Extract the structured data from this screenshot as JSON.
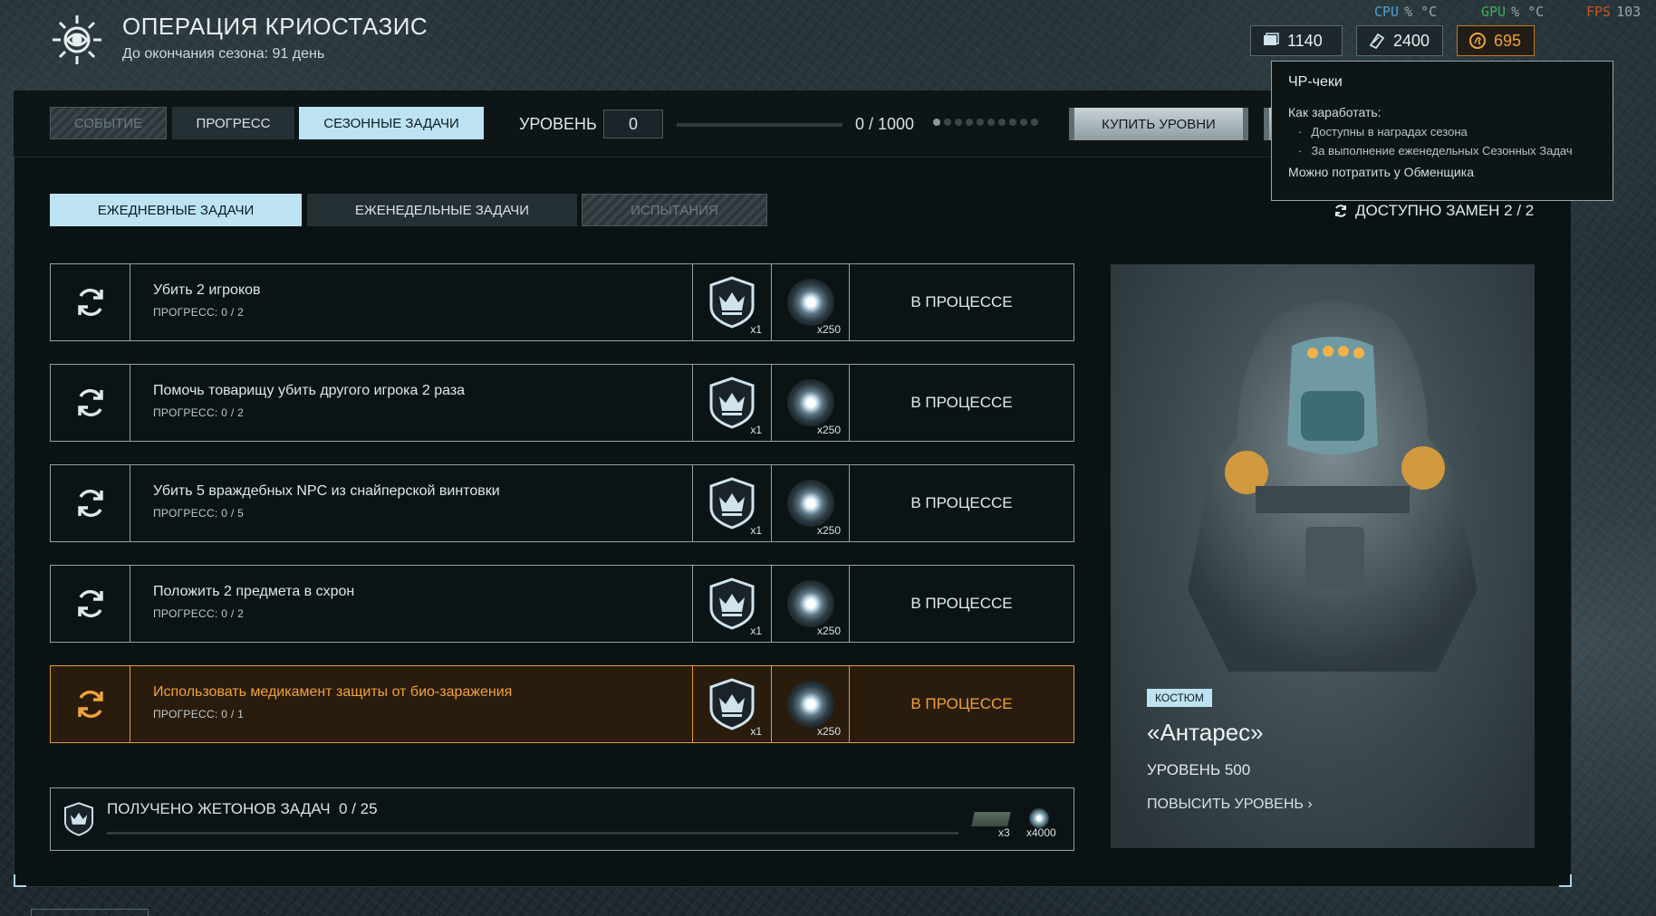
{
  "header": {
    "title": "ОПЕРАЦИЯ КРИОСТАЗИС",
    "subtitle": "До окончания сезона: 91 день"
  },
  "perf": {
    "cpu_label": "CPU",
    "cpu_value": "% °C",
    "gpu_label": "GPU",
    "gpu_value": "% °C",
    "fps_label": "FPS",
    "fps_value": "103"
  },
  "currencies": [
    {
      "icon": "tickets-icon",
      "value": "1140"
    },
    {
      "icon": "chr-checks-icon",
      "value": "2400"
    },
    {
      "icon": "coin-icon",
      "value": "695",
      "color": "#f0a23a"
    }
  ],
  "top_tabs": [
    {
      "label": "СОБЫТИЕ",
      "state": "disabled"
    },
    {
      "label": "ПРОГРЕСС",
      "state": "normal"
    },
    {
      "label": "СЕЗОННЫЕ ЗАДАЧИ",
      "state": "active"
    }
  ],
  "level": {
    "label": "УРОВЕНЬ",
    "value": "0",
    "progress_text": "0 / 1000",
    "progress": 0
  },
  "buy_levels_label": "КУПИТЬ УРОВНИ",
  "sub_tabs": [
    {
      "label": "ЕЖЕДНЕВНЫЕ ЗАДАЧИ",
      "state": "active"
    },
    {
      "label": "ЕЖЕНЕДЕЛЬНЫЕ ЗАДАЧИ",
      "state": "normal"
    },
    {
      "label": "ИСПЫТАНИЯ",
      "state": "disabled"
    }
  ],
  "swaps": "ДОСТУПНО ЗАМЕН 2 / 2",
  "tasks": [
    {
      "name": "Убить 2 игроков",
      "progress": "ПРОГРЕСС: 0 / 2",
      "reward1": "x1",
      "reward2": "x250",
      "status": "В ПРОЦЕССЕ",
      "highlighted": false
    },
    {
      "name": "Помочь товарищу убить другого игрока 2 раза",
      "progress": "ПРОГРЕСС: 0 / 2",
      "reward1": "x1",
      "reward2": "x250",
      "status": "В ПРОЦЕССЕ",
      "highlighted": false
    },
    {
      "name": "Убить 5 враждебных NPC из снайперской винтовки",
      "progress": "ПРОГРЕСС: 0 / 5",
      "reward1": "x1",
      "reward2": "x250",
      "status": "В ПРОЦЕССЕ",
      "highlighted": false
    },
    {
      "name": "Положить 2 предмета в схрон",
      "progress": "ПРОГРЕСС: 0 / 2",
      "reward1": "x1",
      "reward2": "x250",
      "status": "В ПРОЦЕССЕ",
      "highlighted": false
    },
    {
      "name": "Использовать медикамент защиты от био-заражения",
      "progress": "ПРОГРЕСС: 0 / 1",
      "reward1": "x1",
      "reward2": "x250",
      "status": "В ПРОЦЕССЕ",
      "highlighted": true
    }
  ],
  "tokens": {
    "label": "ПОЛУЧЕНО ЖЕТОНОВ ЗАДАЧ",
    "count": "0 / 25",
    "progress": 0,
    "reward1": "x3",
    "reward2": "x4000"
  },
  "promo": {
    "badge": "КОСТЮМ",
    "name": "«Антарес»",
    "level": "УРОВЕНЬ 500",
    "upgrade": "ПОВЫСИТЬ УРОВЕНЬ"
  },
  "tooltip": {
    "title": "ЧР-чеки",
    "how": "Как заработать:",
    "items": [
      "Доступны в наградах сезона",
      "За выполнение еженедельных Сезонных Задач"
    ],
    "footer": "Можно потратить у Обменщика"
  },
  "colors": {
    "accent": "#bde3f2",
    "highlight": "#e69a3a",
    "orange_text": "#f0a23a"
  }
}
